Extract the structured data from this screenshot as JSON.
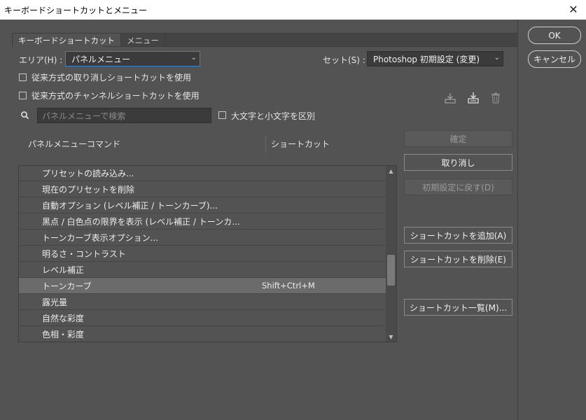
{
  "window": {
    "title": "キーボードショートカットとメニュー",
    "close_glyph": "✕"
  },
  "tabs": [
    {
      "label": "キーボードショートカット",
      "active": true
    },
    {
      "label": "メニュー",
      "active": false
    }
  ],
  "area": {
    "label": "エリア(H) :",
    "value": "パネルメニュー"
  },
  "set": {
    "label": "セット(S) :",
    "value": "Photoshop 初期設定 (変更)"
  },
  "options": {
    "undo_shortcut": "従来方式の取り消しショートカットを使用",
    "channel_shortcut": "従来方式のチャンネルショートカットを使用",
    "case_sensitive": "大文字と小文字を区別"
  },
  "search": {
    "placeholder": "パネルメニューで検索"
  },
  "icons": [
    "save-set-icon",
    "new-set-icon",
    "delete-set-icon",
    "search-icon"
  ],
  "table": {
    "headers": {
      "command": "パネルメニューコマンド",
      "shortcut": "ショートカット"
    },
    "rows": [
      {
        "command": "プリセットの読み込み...",
        "shortcut": ""
      },
      {
        "command": "現在のプリセットを削除",
        "shortcut": ""
      },
      {
        "command": "自動オプション (レベル補正 / トーンカーブ)...",
        "shortcut": ""
      },
      {
        "command": "黒点 / 白色点の限界を表示 (レベル補正 / トーンカ...",
        "shortcut": ""
      },
      {
        "command": "トーンカーブ表示オプション...",
        "shortcut": ""
      },
      {
        "command": "明るさ・コントラスト",
        "shortcut": ""
      },
      {
        "command": "レベル補正",
        "shortcut": ""
      },
      {
        "command": "トーンカーブ",
        "shortcut": "Shift+Ctrl+M",
        "selected": true
      },
      {
        "command": "露光量",
        "shortcut": ""
      },
      {
        "command": "自然な彩度",
        "shortcut": ""
      },
      {
        "command": "色相・彩度",
        "shortcut": ""
      }
    ]
  },
  "buttons": {
    "ok": "OK",
    "cancel": "キャンセル",
    "accept": "確定",
    "undo": "取り消し",
    "reset": "初期設定に戻す(D)",
    "add": "ショートカットを追加(A)",
    "delete": "ショートカットを削除(E)",
    "summary": "ショートカット一覧(M)..."
  },
  "colors": {
    "background": "#535353",
    "focus": "#3c82c8",
    "selected_row": "#6b6b6b"
  }
}
